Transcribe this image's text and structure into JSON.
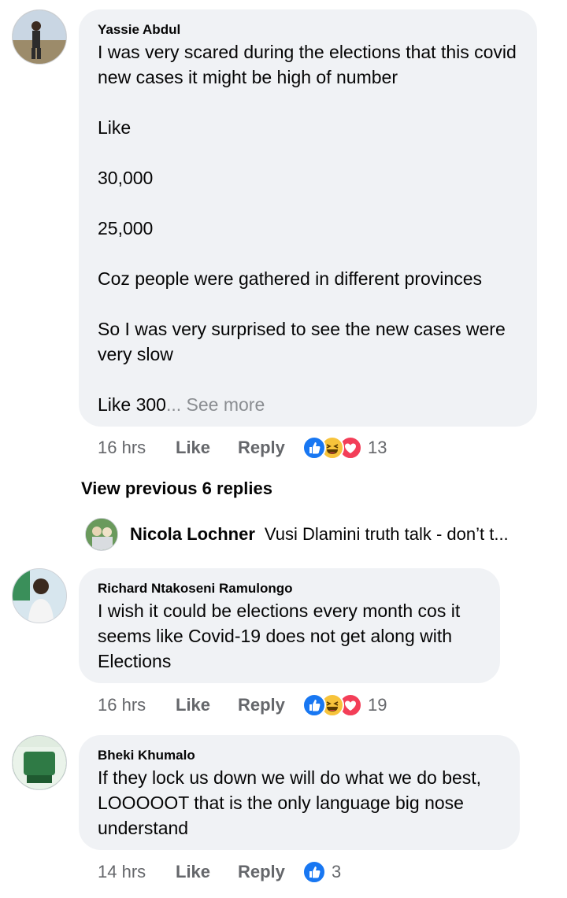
{
  "comments": [
    {
      "author": "Yassie Abdul",
      "lines": [
        "I was very scared during the elections that this covid new cases it might be high of number",
        "",
        "Like",
        "",
        "30,000",
        "",
        "25,000",
        "",
        "Coz people were gathered in different provinces",
        "",
        "So I was very surprised to see the new cases were very slow",
        "",
        "Like 300"
      ],
      "see_more": "... See more",
      "time": "16 hrs",
      "like_label": "Like",
      "reply_label": "Reply",
      "reaction_count": "13"
    },
    {
      "author": "Richard Ntakoseni Ramulongo",
      "lines": [
        "I wish it could be elections every month cos it seems like Covid-19 does not get along with Elections"
      ],
      "time": "16 hrs",
      "like_label": "Like",
      "reply_label": "Reply",
      "reaction_count": "19"
    },
    {
      "author": "Bheki Khumalo",
      "lines": [
        "If they lock us down we will do what we do best, LOOOOOT that is the only language big nose understand"
      ],
      "time": "14 hrs",
      "like_label": "Like",
      "reply_label": "Reply",
      "reaction_count": "3"
    }
  ],
  "view_previous": "View previous 6 replies",
  "collapsed_reply": {
    "author": "Nicola Lochner",
    "preview": "Vusi Dlamini truth talk - don’t t..."
  },
  "colors": {
    "bubble": "#f0f2f5",
    "meta_text": "#65676b",
    "like_blue": "#1877f2",
    "haha_yellow": "#f7c33b",
    "love_red": "#f33e58"
  },
  "icons": [
    "like-reaction-icon",
    "haha-reaction-icon",
    "love-reaction-icon"
  ]
}
